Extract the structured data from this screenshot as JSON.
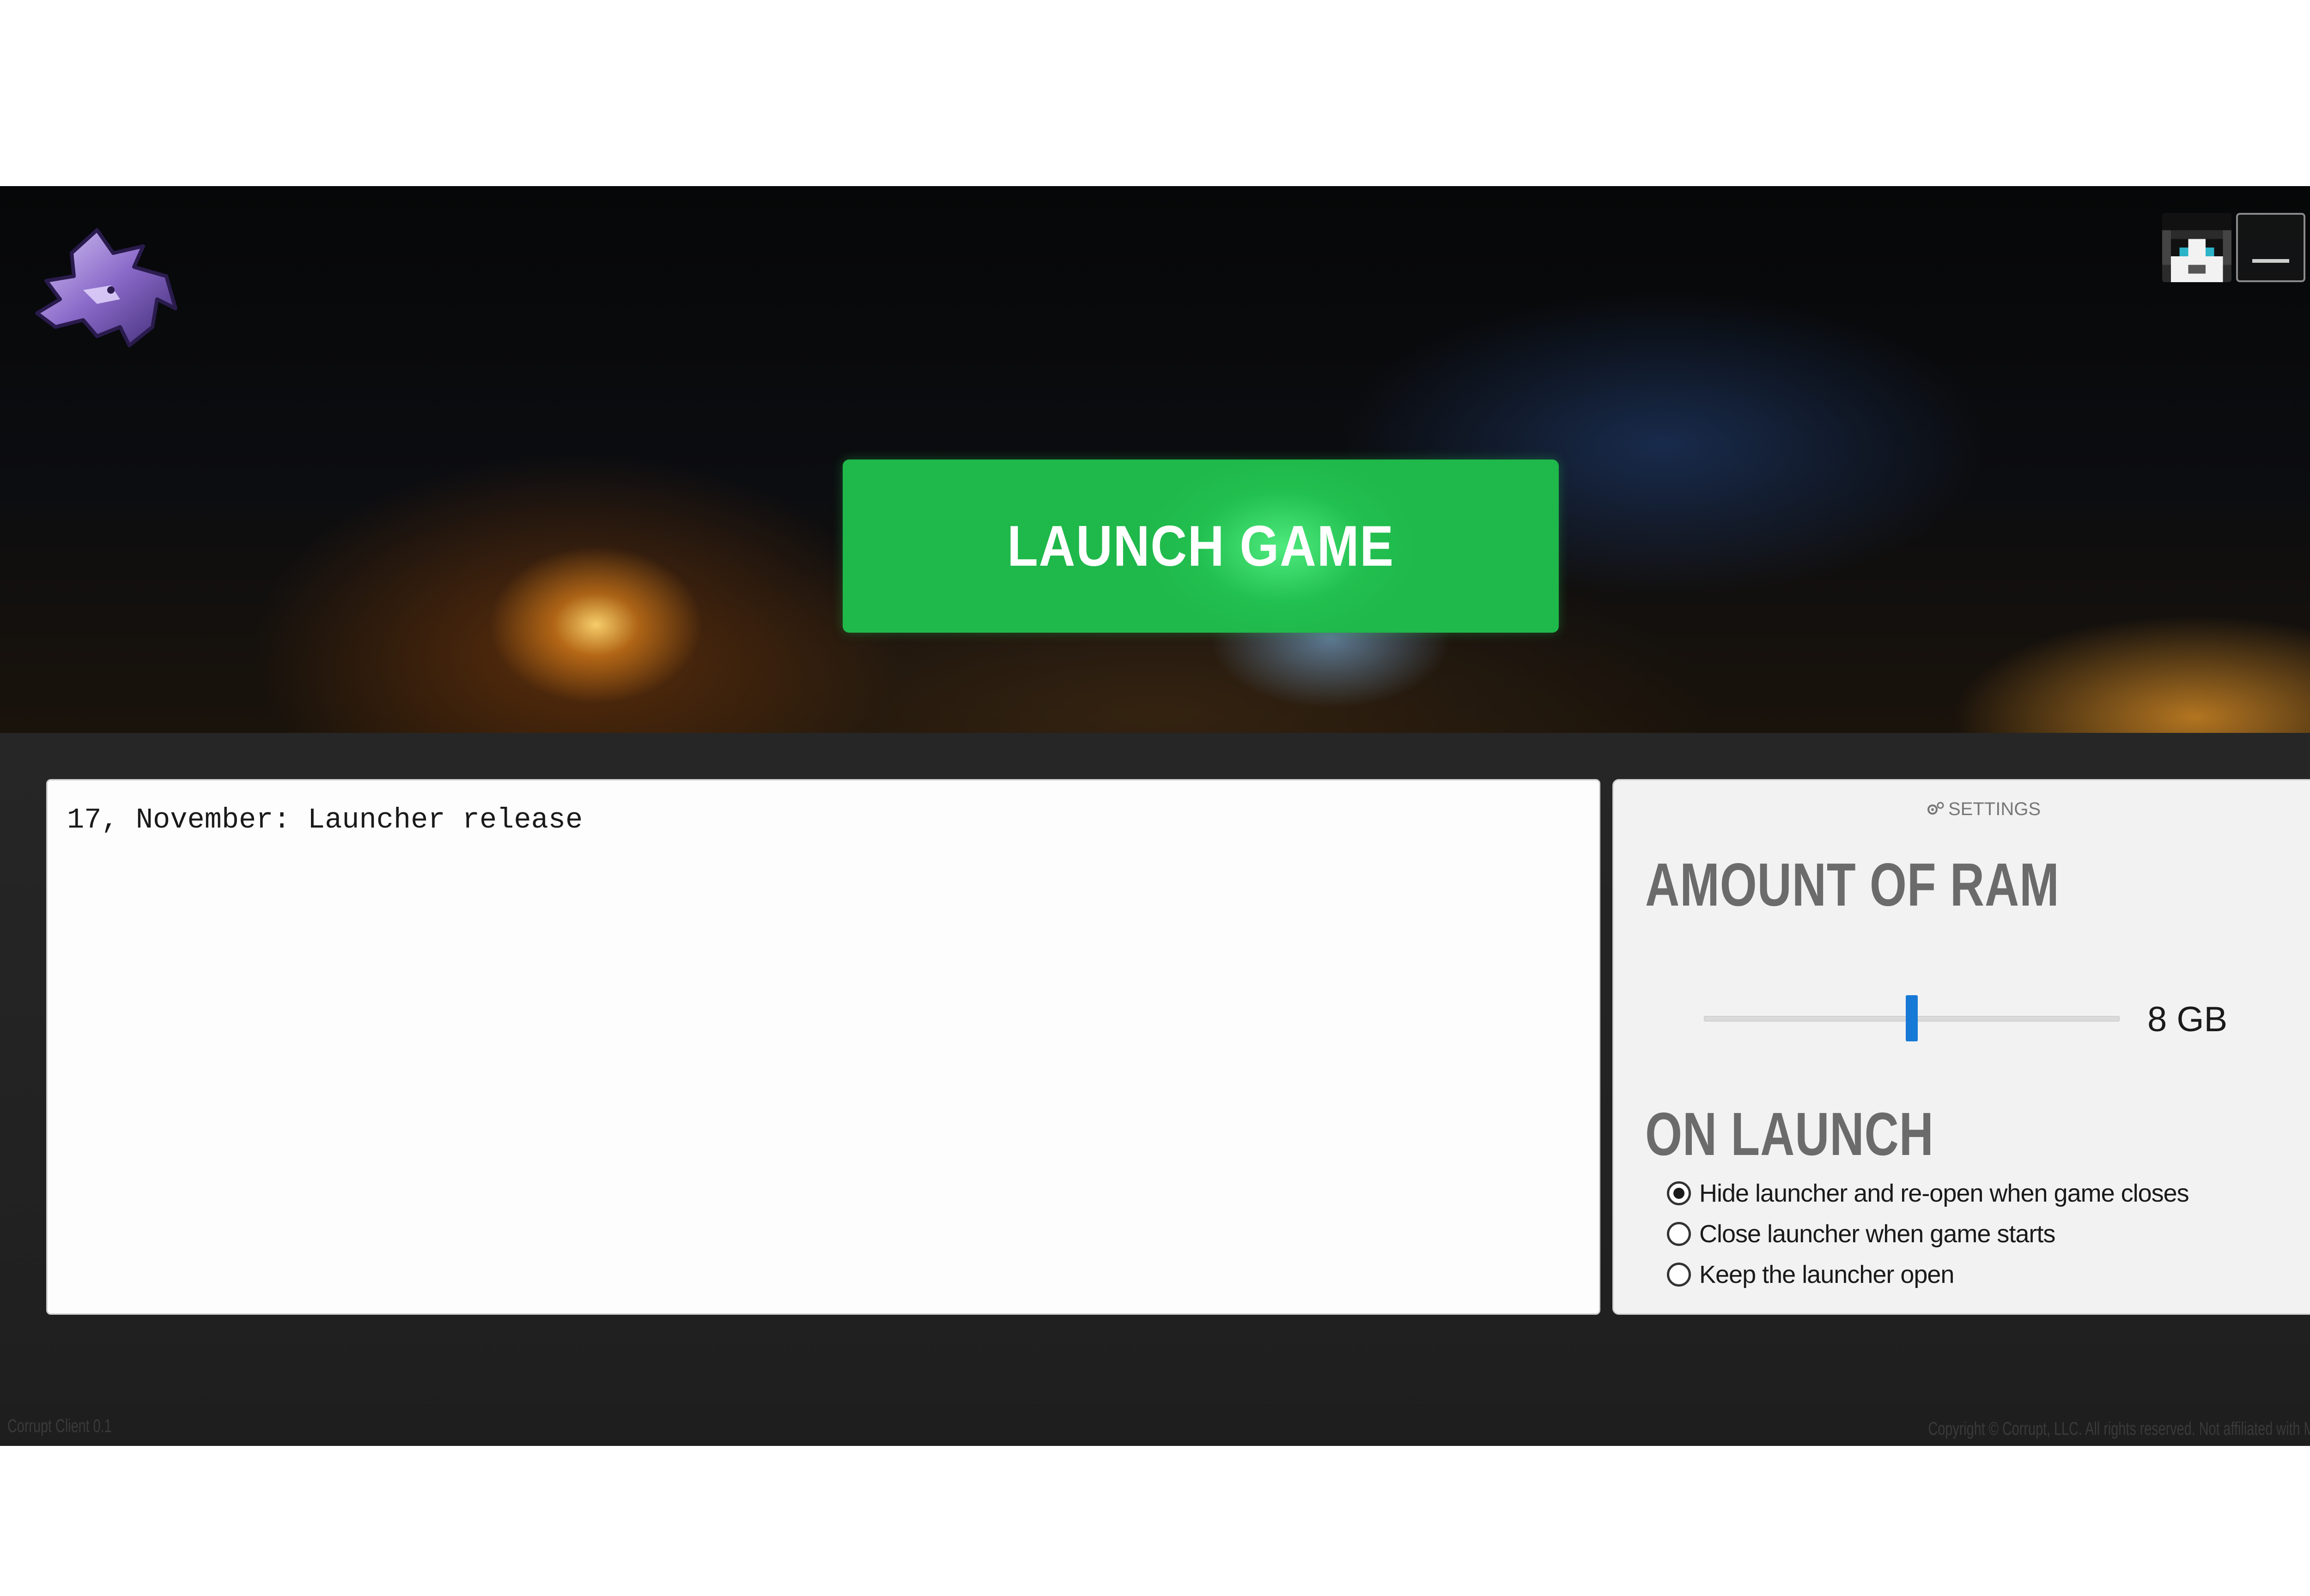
{
  "app": {
    "logo_icon": "wolf-logo-icon",
    "profile_icon": "player-avatar-icon",
    "minimize_icon": "minimize-icon",
    "close_icon": "close-icon"
  },
  "hero": {
    "launch_label": "LAUNCH GAME",
    "accent_color": "#22c050"
  },
  "news": {
    "text": "17, November: Launcher release"
  },
  "settings": {
    "header_icon": "gear-icon",
    "header_label": "SETTINGS",
    "ram_title": "AMOUNT OF RAM",
    "ram_value_label": "8 GB",
    "ram_slider_fraction": 0.5,
    "slider_color": "#1779d6",
    "on_launch_title": "ON LAUNCH",
    "on_launch_options": [
      {
        "label": "Hide launcher and re-open when game closes",
        "checked": true
      },
      {
        "label": "Close launcher when game starts",
        "checked": false
      },
      {
        "label": "Keep the launcher open",
        "checked": false
      }
    ]
  },
  "footer": {
    "version": "Corrupt Client 0.1",
    "copyright": "Copyright © Corrupt, LLC. All rights reserved. Not affiliated with Mojang AB."
  }
}
